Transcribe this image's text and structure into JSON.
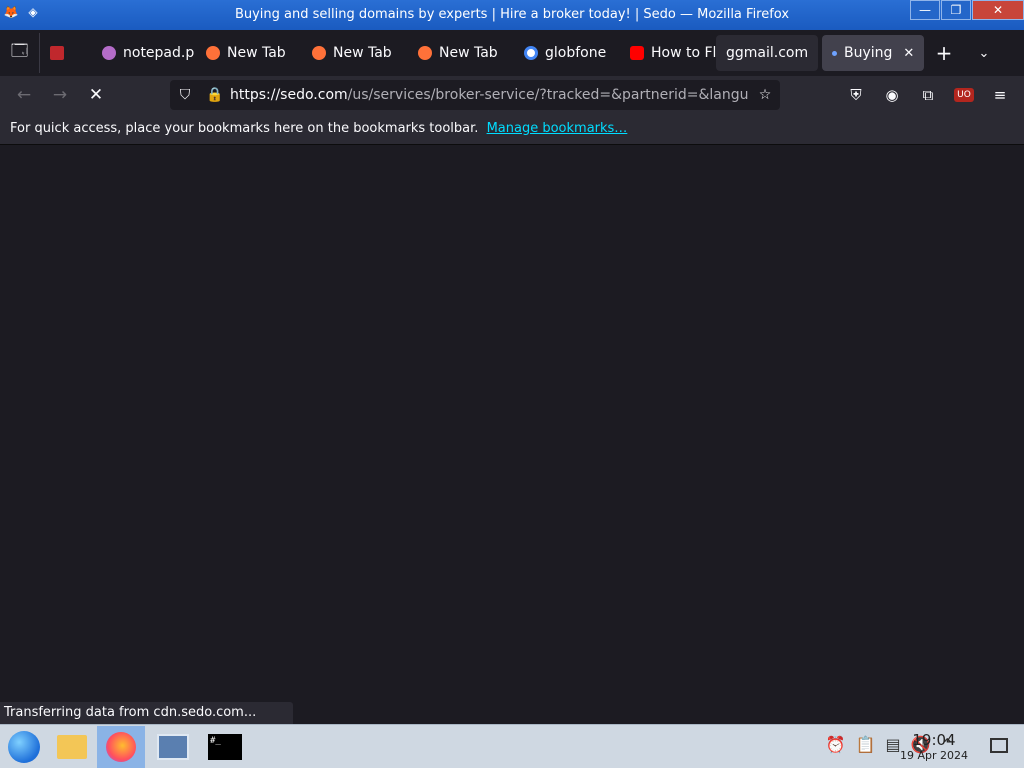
{
  "window": {
    "title": "Buying and selling domains by experts | Hire a broker today! | Sedo — Mozilla Firefox",
    "controls": {
      "minimize": "—",
      "maximize": "❐",
      "close": "✕"
    }
  },
  "tabs": [
    {
      "label": "notepad.p",
      "icon": "notepad-icon",
      "color": "#b46cc9"
    },
    {
      "label": "New Tab",
      "icon": "firefox-icon",
      "color": "#ff7139"
    },
    {
      "label": "New Tab",
      "icon": "firefox-icon",
      "color": "#ff7139"
    },
    {
      "label": "New Tab",
      "icon": "firefox-icon",
      "color": "#ff7139"
    },
    {
      "label": "globfone",
      "icon": "google-icon",
      "color": "#4285f4"
    },
    {
      "label": "How to Fl",
      "icon": "youtube-icon",
      "color": "#ff0000"
    },
    {
      "label": "ggmail.com",
      "icon": "none",
      "color": ""
    },
    {
      "label": "Buying",
      "icon": "loading-dot-icon",
      "color": "#6ea2ff"
    }
  ],
  "navbar": {
    "url_domain": "https://sedo.com",
    "url_rest": "/us/services/broker-service/?tracked=&partnerid=&langu"
  },
  "bookmarks_bar": {
    "message": "For quick access, place your bookmarks here on the bookmarks toolbar.",
    "link": "Manage bookmarks…"
  },
  "status": "Transferring data from cdn.sedo.com...",
  "taskbar": {
    "time": "19:04",
    "date": "19 Apr 2024",
    "active_color": "#8ab3e6"
  }
}
